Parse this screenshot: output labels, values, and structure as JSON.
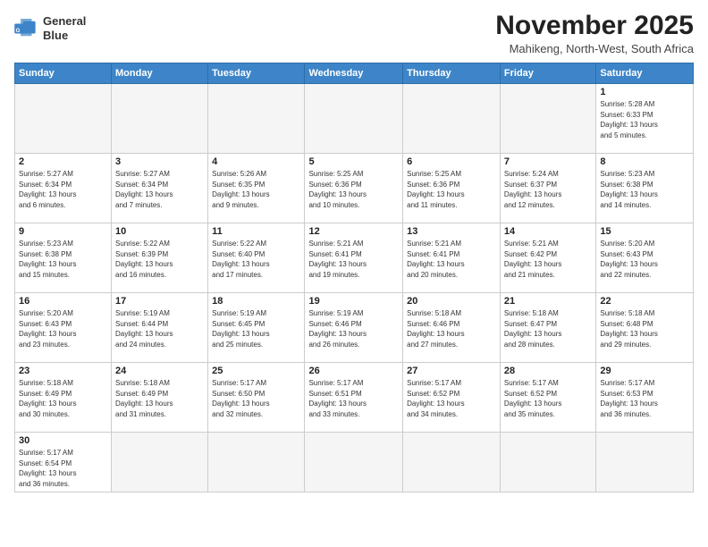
{
  "logo": {
    "line1": "General",
    "line2": "Blue"
  },
  "title": "November 2025",
  "subtitle": "Mahikeng, North-West, South Africa",
  "weekdays": [
    "Sunday",
    "Monday",
    "Tuesday",
    "Wednesday",
    "Thursday",
    "Friday",
    "Saturday"
  ],
  "weeks": [
    [
      {
        "day": "",
        "info": ""
      },
      {
        "day": "",
        "info": ""
      },
      {
        "day": "",
        "info": ""
      },
      {
        "day": "",
        "info": ""
      },
      {
        "day": "",
        "info": ""
      },
      {
        "day": "",
        "info": ""
      },
      {
        "day": "1",
        "info": "Sunrise: 5:28 AM\nSunset: 6:33 PM\nDaylight: 13 hours\nand 5 minutes."
      }
    ],
    [
      {
        "day": "2",
        "info": "Sunrise: 5:27 AM\nSunset: 6:34 PM\nDaylight: 13 hours\nand 6 minutes."
      },
      {
        "day": "3",
        "info": "Sunrise: 5:27 AM\nSunset: 6:34 PM\nDaylight: 13 hours\nand 7 minutes."
      },
      {
        "day": "4",
        "info": "Sunrise: 5:26 AM\nSunset: 6:35 PM\nDaylight: 13 hours\nand 9 minutes."
      },
      {
        "day": "5",
        "info": "Sunrise: 5:25 AM\nSunset: 6:36 PM\nDaylight: 13 hours\nand 10 minutes."
      },
      {
        "day": "6",
        "info": "Sunrise: 5:25 AM\nSunset: 6:36 PM\nDaylight: 13 hours\nand 11 minutes."
      },
      {
        "day": "7",
        "info": "Sunrise: 5:24 AM\nSunset: 6:37 PM\nDaylight: 13 hours\nand 12 minutes."
      },
      {
        "day": "8",
        "info": "Sunrise: 5:23 AM\nSunset: 6:38 PM\nDaylight: 13 hours\nand 14 minutes."
      }
    ],
    [
      {
        "day": "9",
        "info": "Sunrise: 5:23 AM\nSunset: 6:38 PM\nDaylight: 13 hours\nand 15 minutes."
      },
      {
        "day": "10",
        "info": "Sunrise: 5:22 AM\nSunset: 6:39 PM\nDaylight: 13 hours\nand 16 minutes."
      },
      {
        "day": "11",
        "info": "Sunrise: 5:22 AM\nSunset: 6:40 PM\nDaylight: 13 hours\nand 17 minutes."
      },
      {
        "day": "12",
        "info": "Sunrise: 5:21 AM\nSunset: 6:41 PM\nDaylight: 13 hours\nand 19 minutes."
      },
      {
        "day": "13",
        "info": "Sunrise: 5:21 AM\nSunset: 6:41 PM\nDaylight: 13 hours\nand 20 minutes."
      },
      {
        "day": "14",
        "info": "Sunrise: 5:21 AM\nSunset: 6:42 PM\nDaylight: 13 hours\nand 21 minutes."
      },
      {
        "day": "15",
        "info": "Sunrise: 5:20 AM\nSunset: 6:43 PM\nDaylight: 13 hours\nand 22 minutes."
      }
    ],
    [
      {
        "day": "16",
        "info": "Sunrise: 5:20 AM\nSunset: 6:43 PM\nDaylight: 13 hours\nand 23 minutes."
      },
      {
        "day": "17",
        "info": "Sunrise: 5:19 AM\nSunset: 6:44 PM\nDaylight: 13 hours\nand 24 minutes."
      },
      {
        "day": "18",
        "info": "Sunrise: 5:19 AM\nSunset: 6:45 PM\nDaylight: 13 hours\nand 25 minutes."
      },
      {
        "day": "19",
        "info": "Sunrise: 5:19 AM\nSunset: 6:46 PM\nDaylight: 13 hours\nand 26 minutes."
      },
      {
        "day": "20",
        "info": "Sunrise: 5:18 AM\nSunset: 6:46 PM\nDaylight: 13 hours\nand 27 minutes."
      },
      {
        "day": "21",
        "info": "Sunrise: 5:18 AM\nSunset: 6:47 PM\nDaylight: 13 hours\nand 28 minutes."
      },
      {
        "day": "22",
        "info": "Sunrise: 5:18 AM\nSunset: 6:48 PM\nDaylight: 13 hours\nand 29 minutes."
      }
    ],
    [
      {
        "day": "23",
        "info": "Sunrise: 5:18 AM\nSunset: 6:49 PM\nDaylight: 13 hours\nand 30 minutes."
      },
      {
        "day": "24",
        "info": "Sunrise: 5:18 AM\nSunset: 6:49 PM\nDaylight: 13 hours\nand 31 minutes."
      },
      {
        "day": "25",
        "info": "Sunrise: 5:17 AM\nSunset: 6:50 PM\nDaylight: 13 hours\nand 32 minutes."
      },
      {
        "day": "26",
        "info": "Sunrise: 5:17 AM\nSunset: 6:51 PM\nDaylight: 13 hours\nand 33 minutes."
      },
      {
        "day": "27",
        "info": "Sunrise: 5:17 AM\nSunset: 6:52 PM\nDaylight: 13 hours\nand 34 minutes."
      },
      {
        "day": "28",
        "info": "Sunrise: 5:17 AM\nSunset: 6:52 PM\nDaylight: 13 hours\nand 35 minutes."
      },
      {
        "day": "29",
        "info": "Sunrise: 5:17 AM\nSunset: 6:53 PM\nDaylight: 13 hours\nand 36 minutes."
      }
    ],
    [
      {
        "day": "30",
        "info": "Sunrise: 5:17 AM\nSunset: 6:54 PM\nDaylight: 13 hours\nand 36 minutes."
      },
      {
        "day": "",
        "info": ""
      },
      {
        "day": "",
        "info": ""
      },
      {
        "day": "",
        "info": ""
      },
      {
        "day": "",
        "info": ""
      },
      {
        "day": "",
        "info": ""
      },
      {
        "day": "",
        "info": ""
      }
    ]
  ]
}
